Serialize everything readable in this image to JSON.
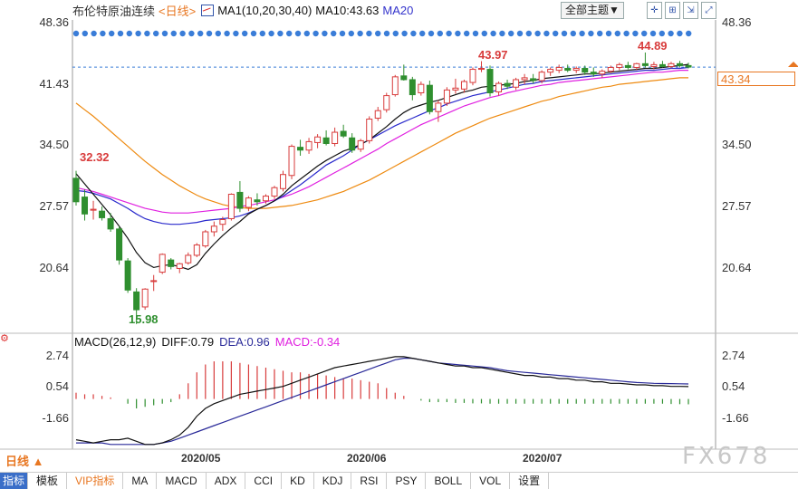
{
  "header": {
    "name": "布伦特原油连续",
    "period": "<日线>",
    "ma_label": "MA1(10,20,30,40)",
    "ma10_label": "MA10:43.63",
    "ma20_label": "MA20",
    "theme_button": "全部主题▼"
  },
  "price_axis": {
    "ticks": [
      "48.36",
      "41.43",
      "34.50",
      "27.57",
      "20.64"
    ],
    "current_price": "43.34"
  },
  "macd": {
    "title": "MACD(26,12,9)",
    "diff": "DIFF:0.79",
    "dea": "DEA:0.96",
    "macd": "MACD:-0.34",
    "ticks": [
      "2.74",
      "0.54",
      "-1.66"
    ]
  },
  "dates": [
    "2020/05",
    "2020/06",
    "2020/07"
  ],
  "period_selector": "日线 ▲",
  "annotations": {
    "low": "15.98",
    "start": "32.32",
    "high1": "43.97",
    "high2": "44.89"
  },
  "watermark": "FX678",
  "tabs": [
    "指标",
    "模板",
    "VIP指标",
    "MA",
    "MACD",
    "ADX",
    "CCI",
    "KD",
    "KDJ",
    "RSI",
    "PSY",
    "BOLL",
    "VOL",
    "设置"
  ],
  "colors": {
    "up": "#d83b3b",
    "down": "#2f8f2f",
    "ma10": "#111111",
    "ma20": "#2a2acc",
    "ma30": "#e020e0",
    "ma40": "#ee8a10",
    "dea": "#2a2a99"
  },
  "chart_data": {
    "type": "candlestick",
    "ylim": [
      15.0,
      48.36
    ],
    "candles": [
      {
        "o": 31.5,
        "h": 32.3,
        "l": 28.6,
        "c": 29.0
      },
      {
        "o": 29.5,
        "h": 30.3,
        "l": 27.0,
        "c": 27.7
      },
      {
        "o": 28.1,
        "h": 29.1,
        "l": 27.1,
        "c": 28.2
      },
      {
        "o": 28.0,
        "h": 28.5,
        "l": 27.0,
        "c": 27.3
      },
      {
        "o": 27.2,
        "h": 27.8,
        "l": 25.8,
        "c": 26.1
      },
      {
        "o": 26.1,
        "h": 26.4,
        "l": 22.3,
        "c": 22.8
      },
      {
        "o": 22.7,
        "h": 23.0,
        "l": 19.3,
        "c": 19.6
      },
      {
        "o": 19.4,
        "h": 19.8,
        "l": 15.98,
        "c": 17.5
      },
      {
        "o": 17.8,
        "h": 19.8,
        "l": 17.5,
        "c": 19.7
      },
      {
        "o": 20.5,
        "h": 21.2,
        "l": 19.5,
        "c": 20.6
      },
      {
        "o": 21.5,
        "h": 23.5,
        "l": 21.3,
        "c": 23.4
      },
      {
        "o": 22.8,
        "h": 23.0,
        "l": 21.8,
        "c": 22.1
      },
      {
        "o": 21.9,
        "h": 22.5,
        "l": 21.4,
        "c": 22.4
      },
      {
        "o": 22.5,
        "h": 23.6,
        "l": 22.3,
        "c": 23.3
      },
      {
        "o": 23.3,
        "h": 24.6,
        "l": 23.1,
        "c": 24.4
      },
      {
        "o": 24.3,
        "h": 26.0,
        "l": 24.1,
        "c": 25.8
      },
      {
        "o": 25.8,
        "h": 26.9,
        "l": 25.3,
        "c": 26.4
      },
      {
        "o": 26.6,
        "h": 27.4,
        "l": 25.9,
        "c": 27.1
      },
      {
        "o": 27.2,
        "h": 29.9,
        "l": 27.0,
        "c": 29.8
      },
      {
        "o": 30.0,
        "h": 31.2,
        "l": 27.9,
        "c": 28.3
      },
      {
        "o": 28.4,
        "h": 29.6,
        "l": 28.0,
        "c": 29.4
      },
      {
        "o": 29.2,
        "h": 29.9,
        "l": 28.6,
        "c": 29.0
      },
      {
        "o": 29.1,
        "h": 29.8,
        "l": 28.8,
        "c": 29.6
      },
      {
        "o": 29.6,
        "h": 30.7,
        "l": 29.3,
        "c": 30.5
      },
      {
        "o": 30.4,
        "h": 32.3,
        "l": 30.1,
        "c": 31.9
      },
      {
        "o": 31.8,
        "h": 35.1,
        "l": 31.4,
        "c": 34.9
      },
      {
        "o": 34.8,
        "h": 35.6,
        "l": 33.9,
        "c": 34.5
      },
      {
        "o": 34.5,
        "h": 35.8,
        "l": 34.1,
        "c": 35.4
      },
      {
        "o": 35.3,
        "h": 36.2,
        "l": 34.7,
        "c": 35.9
      },
      {
        "o": 35.8,
        "h": 36.6,
        "l": 35.0,
        "c": 35.2
      },
      {
        "o": 35.2,
        "h": 36.9,
        "l": 34.9,
        "c": 36.4
      },
      {
        "o": 36.5,
        "h": 37.2,
        "l": 35.8,
        "c": 36.0
      },
      {
        "o": 35.8,
        "h": 36.3,
        "l": 34.2,
        "c": 34.5
      },
      {
        "o": 34.6,
        "h": 35.7,
        "l": 34.3,
        "c": 35.5
      },
      {
        "o": 35.5,
        "h": 38.1,
        "l": 35.2,
        "c": 37.8
      },
      {
        "o": 37.9,
        "h": 39.1,
        "l": 37.6,
        "c": 38.7
      },
      {
        "o": 38.8,
        "h": 40.6,
        "l": 38.5,
        "c": 40.3
      },
      {
        "o": 40.4,
        "h": 42.5,
        "l": 40.2,
        "c": 42.3
      },
      {
        "o": 42.4,
        "h": 43.6,
        "l": 41.9,
        "c": 42.0
      },
      {
        "o": 42.0,
        "h": 42.3,
        "l": 39.8,
        "c": 40.4
      },
      {
        "o": 40.6,
        "h": 41.8,
        "l": 40.3,
        "c": 41.5
      },
      {
        "o": 41.4,
        "h": 41.9,
        "l": 38.3,
        "c": 38.6
      },
      {
        "o": 38.6,
        "h": 39.8,
        "l": 37.5,
        "c": 39.5
      },
      {
        "o": 39.5,
        "h": 41.2,
        "l": 39.2,
        "c": 40.9
      },
      {
        "o": 40.9,
        "h": 42.1,
        "l": 40.5,
        "c": 41.1
      },
      {
        "o": 41.0,
        "h": 42.0,
        "l": 40.6,
        "c": 41.8
      },
      {
        "o": 41.7,
        "h": 43.3,
        "l": 41.4,
        "c": 43.1
      },
      {
        "o": 43.1,
        "h": 43.97,
        "l": 42.8,
        "c": 43.2
      },
      {
        "o": 43.1,
        "h": 43.5,
        "l": 40.2,
        "c": 40.6
      },
      {
        "o": 40.7,
        "h": 41.8,
        "l": 40.3,
        "c": 41.6
      },
      {
        "o": 41.6,
        "h": 42.0,
        "l": 41.0,
        "c": 41.3
      },
      {
        "o": 41.2,
        "h": 42.2,
        "l": 40.9,
        "c": 42.0
      },
      {
        "o": 42.0,
        "h": 42.6,
        "l": 41.5,
        "c": 42.2
      },
      {
        "o": 42.1,
        "h": 42.6,
        "l": 41.6,
        "c": 41.9
      },
      {
        "o": 41.9,
        "h": 43.0,
        "l": 41.6,
        "c": 42.8
      },
      {
        "o": 42.8,
        "h": 43.3,
        "l": 42.4,
        "c": 43.1
      },
      {
        "o": 43.0,
        "h": 43.6,
        "l": 42.7,
        "c": 43.3
      },
      {
        "o": 43.2,
        "h": 43.6,
        "l": 42.8,
        "c": 43.0
      },
      {
        "o": 43.0,
        "h": 43.4,
        "l": 42.7,
        "c": 43.2
      },
      {
        "o": 43.2,
        "h": 43.5,
        "l": 42.5,
        "c": 42.8
      },
      {
        "o": 42.8,
        "h": 43.3,
        "l": 42.3,
        "c": 42.6
      },
      {
        "o": 42.6,
        "h": 43.1,
        "l": 42.2,
        "c": 42.9
      },
      {
        "o": 42.9,
        "h": 43.5,
        "l": 42.7,
        "c": 43.3
      },
      {
        "o": 43.3,
        "h": 43.8,
        "l": 43.0,
        "c": 43.6
      },
      {
        "o": 43.5,
        "h": 43.9,
        "l": 43.1,
        "c": 43.3
      },
      {
        "o": 43.3,
        "h": 43.8,
        "l": 43.0,
        "c": 43.7
      },
      {
        "o": 43.7,
        "h": 44.89,
        "l": 43.3,
        "c": 43.5
      },
      {
        "o": 43.4,
        "h": 43.9,
        "l": 43.1,
        "c": 43.6
      },
      {
        "o": 43.6,
        "h": 44.0,
        "l": 43.3,
        "c": 43.4
      },
      {
        "o": 43.4,
        "h": 43.9,
        "l": 43.2,
        "c": 43.7
      },
      {
        "o": 43.7,
        "h": 44.0,
        "l": 43.3,
        "c": 43.5
      },
      {
        "o": 43.5,
        "h": 43.8,
        "l": 43.2,
        "c": 43.34
      }
    ],
    "ma10": [
      32.0,
      30.9,
      29.8,
      28.7,
      27.6,
      26.4,
      25.1,
      23.6,
      22.5,
      22.0,
      22.2,
      22.3,
      22.1,
      21.8,
      22.3,
      23.5,
      24.5,
      25.4,
      26.2,
      26.9,
      27.7,
      28.2,
      28.6,
      29.1,
      29.8,
      30.7,
      31.4,
      32.1,
      32.8,
      33.4,
      33.9,
      34.4,
      34.7,
      35.1,
      35.6,
      36.3,
      37.0,
      37.8,
      38.5,
      39.0,
      39.3,
      39.6,
      39.8,
      40.1,
      40.4,
      40.7,
      40.9,
      41.2,
      41.3,
      41.4,
      41.5,
      41.6,
      41.8,
      41.9,
      42.1,
      42.2,
      42.3,
      42.4,
      42.5,
      42.6,
      42.6,
      42.7,
      42.8,
      42.9,
      43.0,
      43.1,
      43.2,
      43.2,
      43.3,
      43.4,
      43.5,
      43.63
    ],
    "ma20": [
      30.2,
      30.1,
      29.9,
      29.6,
      29.3,
      28.8,
      28.3,
      27.7,
      27.2,
      26.9,
      26.7,
      26.6,
      26.6,
      26.7,
      26.8,
      27.0,
      27.1,
      27.2,
      27.3,
      27.5,
      27.8,
      28.2,
      28.6,
      29.1,
      29.6,
      30.2,
      30.8,
      31.5,
      32.2,
      32.9,
      33.4,
      33.9,
      34.5,
      35.1,
      35.6,
      36.1,
      36.6,
      37.1,
      37.5,
      37.9,
      38.3,
      38.7,
      39.0,
      39.4,
      39.7,
      40.0,
      40.3,
      40.5,
      40.7,
      40.9,
      41.1,
      41.3,
      41.5,
      41.6,
      41.8,
      41.9,
      42.0,
      42.1,
      42.2,
      42.3,
      42.4,
      42.5,
      42.6,
      42.7,
      42.8,
      42.9,
      43.0,
      43.0,
      43.1,
      43.2,
      43.2,
      43.3
    ],
    "ma30": [
      30.5,
      30.3,
      30.1,
      29.8,
      29.5,
      29.2,
      28.9,
      28.6,
      28.3,
      28.1,
      27.9,
      27.8,
      27.8,
      27.8,
      27.9,
      28.0,
      28.1,
      28.2,
      28.3,
      28.5,
      28.6,
      28.8,
      29.0,
      29.2,
      29.5,
      29.8,
      30.2,
      30.6,
      31.1,
      31.6,
      32.1,
      32.6,
      33.1,
      33.6,
      34.1,
      34.6,
      35.2,
      35.7,
      36.2,
      36.7,
      37.2,
      37.6,
      38.0,
      38.4,
      38.8,
      39.2,
      39.5,
      39.8,
      40.1,
      40.3,
      40.6,
      40.8,
      41.0,
      41.2,
      41.4,
      41.5,
      41.7,
      41.8,
      41.9,
      42.0,
      42.1,
      42.2,
      42.3,
      42.4,
      42.5,
      42.6,
      42.7,
      42.8,
      42.8,
      42.9,
      43.0,
      43.0
    ],
    "ma40": [
      39.5,
      38.8,
      38.1,
      37.3,
      36.5,
      35.7,
      34.9,
      34.1,
      33.3,
      32.6,
      31.9,
      31.3,
      30.7,
      30.2,
      29.7,
      29.3,
      29.0,
      28.7,
      28.5,
      28.4,
      28.3,
      28.3,
      28.3,
      28.4,
      28.5,
      28.6,
      28.8,
      29.0,
      29.2,
      29.5,
      29.8,
      30.1,
      30.5,
      30.9,
      31.3,
      31.8,
      32.3,
      32.8,
      33.3,
      33.8,
      34.3,
      34.8,
      35.3,
      35.8,
      36.3,
      36.7,
      37.1,
      37.5,
      37.9,
      38.2,
      38.5,
      38.8,
      39.1,
      39.4,
      39.7,
      39.9,
      40.2,
      40.4,
      40.6,
      40.8,
      41.0,
      41.2,
      41.3,
      41.5,
      41.6,
      41.7,
      41.8,
      41.9,
      42.0,
      42.1,
      42.2,
      42.2
    ],
    "macd_ylim": [
      -3.2,
      3.5
    ],
    "diff": [
      -2.6,
      -2.7,
      -2.8,
      -2.7,
      -2.6,
      -2.6,
      -2.5,
      -2.7,
      -2.9,
      -2.9,
      -2.8,
      -2.6,
      -2.3,
      -1.8,
      -1.1,
      -0.6,
      -0.3,
      -0.1,
      0.1,
      0.3,
      0.4,
      0.5,
      0.6,
      0.7,
      0.8,
      1.0,
      1.2,
      1.4,
      1.6,
      1.8,
      2.0,
      2.1,
      2.2,
      2.3,
      2.4,
      2.5,
      2.6,
      2.7,
      2.7,
      2.6,
      2.5,
      2.4,
      2.3,
      2.2,
      2.1,
      2.1,
      2.0,
      2.0,
      1.9,
      1.8,
      1.7,
      1.6,
      1.5,
      1.5,
      1.4,
      1.4,
      1.3,
      1.3,
      1.2,
      1.2,
      1.1,
      1.1,
      1.0,
      1.0,
      0.95,
      0.9,
      0.9,
      0.85,
      0.85,
      0.8,
      0.8,
      0.79
    ],
    "dea": [
      -2.8,
      -2.8,
      -2.8,
      -2.8,
      -2.9,
      -2.9,
      -2.9,
      -2.9,
      -2.9,
      -2.9,
      -2.8,
      -2.7,
      -2.5,
      -2.3,
      -2.1,
      -1.9,
      -1.7,
      -1.5,
      -1.3,
      -1.1,
      -0.9,
      -0.7,
      -0.5,
      -0.3,
      -0.1,
      0.1,
      0.3,
      0.5,
      0.7,
      0.9,
      1.1,
      1.3,
      1.5,
      1.7,
      1.9,
      2.1,
      2.3,
      2.5,
      2.6,
      2.6,
      2.5,
      2.4,
      2.3,
      2.25,
      2.2,
      2.15,
      2.1,
      2.05,
      2.0,
      1.9,
      1.8,
      1.75,
      1.7,
      1.65,
      1.6,
      1.55,
      1.5,
      1.45,
      1.4,
      1.35,
      1.3,
      1.25,
      1.2,
      1.15,
      1.1,
      1.05,
      1.03,
      1.0,
      0.99,
      0.98,
      0.97,
      0.96
    ],
    "macd_hist": [
      0.4,
      0.3,
      0.3,
      0.2,
      0.1,
      0.0,
      -0.3,
      -0.6,
      -0.5,
      -0.4,
      -0.3,
      -0.2,
      0.3,
      1.0,
      1.7,
      2.2,
      2.4,
      2.4,
      2.4,
      2.3,
      2.2,
      2.1,
      2.0,
      1.9,
      1.8,
      1.7,
      1.7,
      1.6,
      1.6,
      1.5,
      1.4,
      1.3,
      1.3,
      1.2,
      1.1,
      1.0,
      0.7,
      0.4,
      0.2,
      0.0,
      -0.1,
      -0.2,
      -0.2,
      -0.2,
      -0.25,
      -0.25,
      -0.28,
      -0.28,
      -0.3,
      -0.3,
      -0.3,
      -0.3,
      -0.3,
      -0.3,
      -0.3,
      -0.3,
      -0.3,
      -0.3,
      -0.3,
      -0.3,
      -0.3,
      -0.3,
      -0.3,
      -0.3,
      -0.3,
      -0.3,
      -0.3,
      -0.3,
      -0.3,
      -0.32,
      -0.33,
      -0.34
    ]
  }
}
